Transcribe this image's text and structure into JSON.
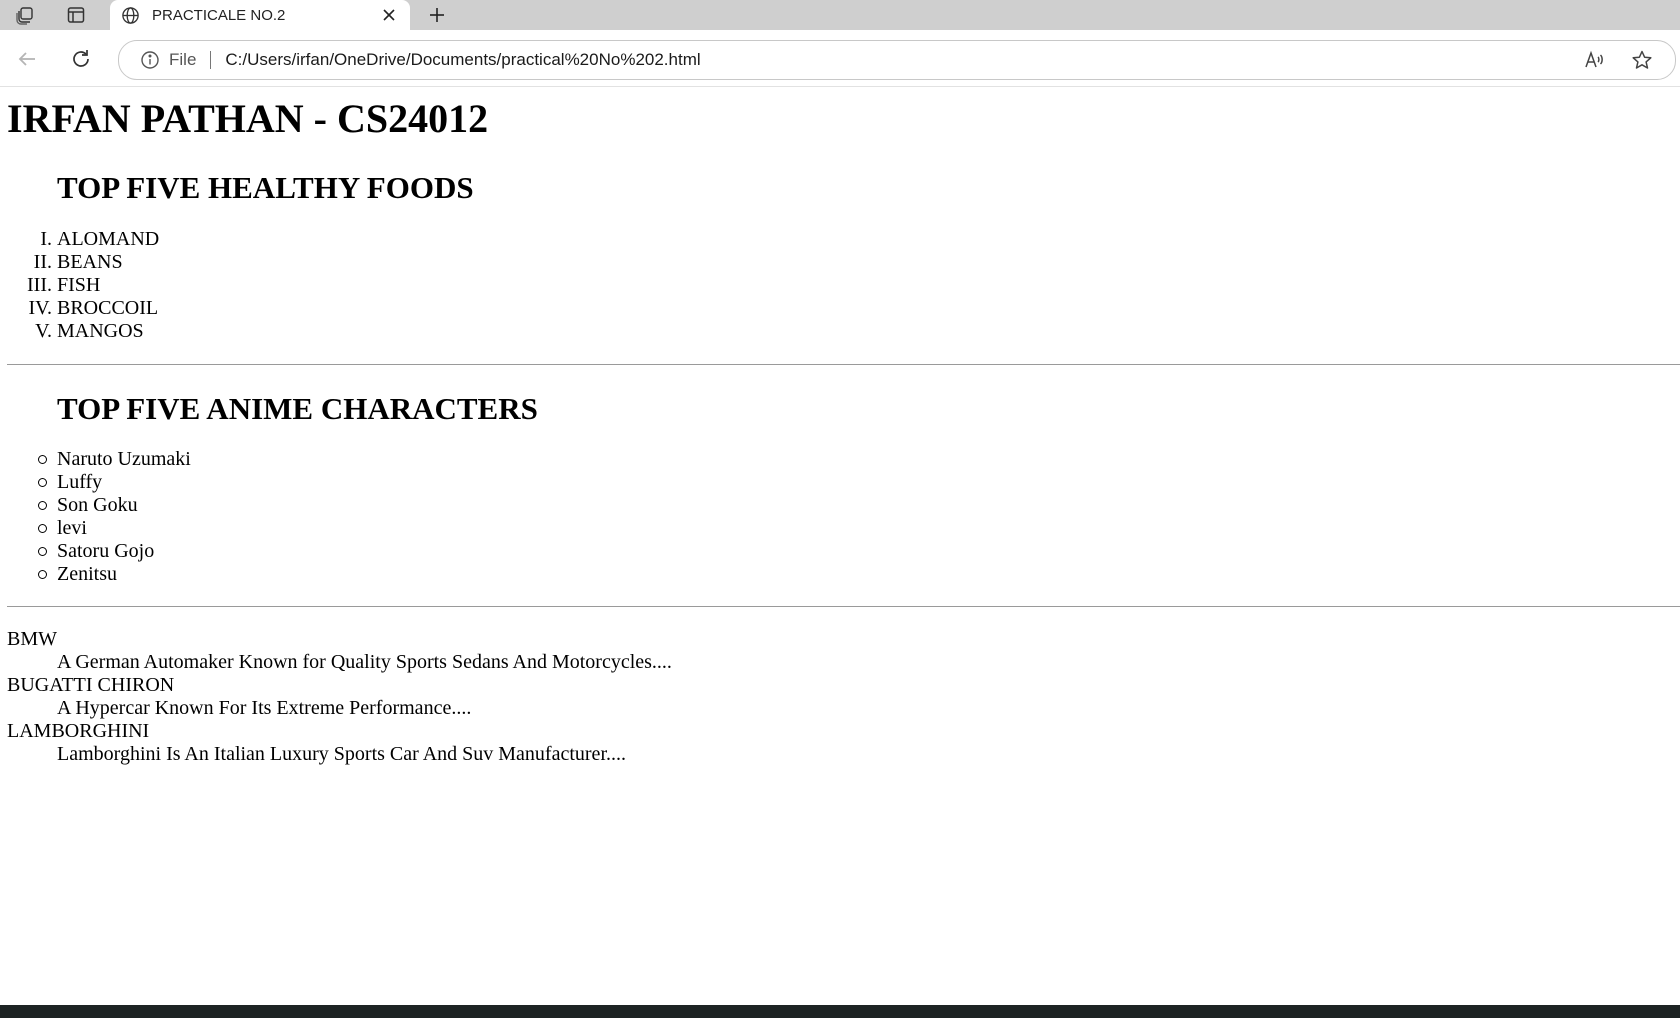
{
  "browser": {
    "tab_title": "PRACTICALE NO.2",
    "scheme_label": "File",
    "address": "C:/Users/irfan/OneDrive/Documents/practical%20No%202.html"
  },
  "page": {
    "heading": "IRFAN PATHAN - CS24012",
    "foods": {
      "title": "TOP FIVE HEALTHY FOODS",
      "items": [
        {
          "marker": "I.",
          "label": "ALOMAND"
        },
        {
          "marker": "II.",
          "label": "BEANS"
        },
        {
          "marker": "III.",
          "label": "FISH"
        },
        {
          "marker": "IV.",
          "label": "BROCCOIL"
        },
        {
          "marker": "V.",
          "label": "MANGOS"
        }
      ]
    },
    "anime": {
      "title": "TOP FIVE ANIME CHARACTERS",
      "items": [
        "Naruto Uzumaki",
        "Luffy",
        "Son Goku",
        "levi",
        "Satoru Gojo",
        "Zenitsu"
      ]
    },
    "cars": [
      {
        "term": "BMW",
        "desc": "A German Automaker Known for Quality Sports Sedans And Motorcycles...."
      },
      {
        "term": "BUGATTI CHIRON",
        "desc": "A Hypercar Known For Its Extreme Performance...."
      },
      {
        "term": "LAMBORGHINI",
        "desc": "Lamborghini Is An Italian Luxury Sports Car And Suv Manufacturer...."
      }
    ]
  }
}
